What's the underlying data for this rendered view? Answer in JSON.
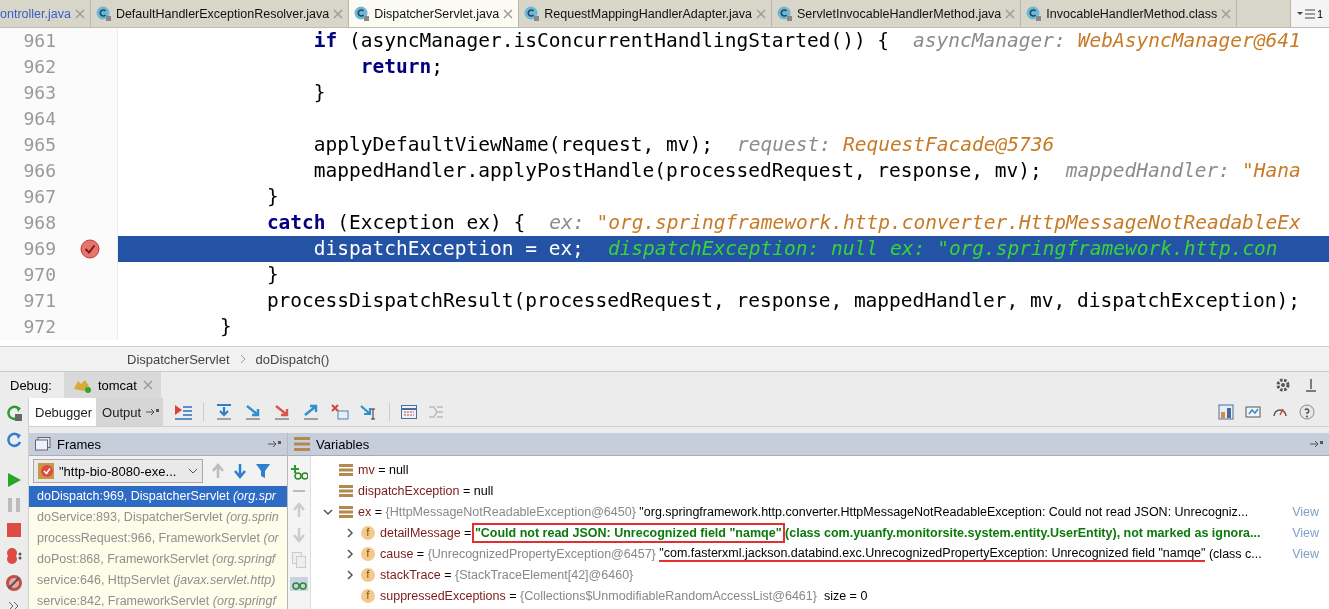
{
  "editor_tabs": [
    {
      "label": "ontroller.java",
      "selected": false,
      "icon": false
    },
    {
      "label": "DefaultHandlerExceptionResolver.java",
      "selected": false,
      "icon": true
    },
    {
      "label": "DispatcherServlet.java",
      "selected": true,
      "icon": true
    },
    {
      "label": "RequestMappingHandlerAdapter.java",
      "selected": false,
      "icon": true
    },
    {
      "label": "ServletInvocableHandlerMethod.java",
      "selected": false,
      "icon": true
    },
    {
      "label": "InvocableHandlerMethod.class",
      "selected": false,
      "icon": true
    }
  ],
  "tab_overflow": "1",
  "code_lines": [
    {
      "number": "961",
      "selected": false,
      "breakpoint": false,
      "segments": [
        {
          "kind": "keyword",
          "text": "                if"
        },
        {
          "kind": "code",
          "text": " (asyncManager.isConcurrentHandlingStarted()) {"
        },
        {
          "kind": "hint",
          "text": "asyncManager:"
        },
        {
          "kind": "hint_value",
          "text": "WebAsyncManager@641"
        }
      ]
    },
    {
      "number": "962",
      "selected": false,
      "breakpoint": false,
      "segments": [
        {
          "kind": "keyword",
          "text": "                    return"
        },
        {
          "kind": "code",
          "text": ";"
        }
      ]
    },
    {
      "number": "963",
      "selected": false,
      "breakpoint": false,
      "segments": [
        {
          "kind": "code",
          "text": "                }"
        }
      ]
    },
    {
      "number": "964",
      "selected": false,
      "breakpoint": false
    },
    {
      "number": "965",
      "selected": false,
      "breakpoint": false,
      "segments": [
        {
          "kind": "code",
          "text": "                applyDefaultViewName(request, mv);"
        },
        {
          "kind": "hint",
          "text": "request:"
        },
        {
          "kind": "hint_value",
          "text": "RequestFacade@5736"
        }
      ]
    },
    {
      "number": "966",
      "selected": false,
      "breakpoint": false,
      "segments": [
        {
          "kind": "code",
          "text": "                mappedHandler.applyPostHandle(processedRequest, response, mv);"
        },
        {
          "kind": "hint",
          "text": "mappedHandler:"
        },
        {
          "kind": "hint_value",
          "text": "\"Hana"
        }
      ]
    },
    {
      "number": "967",
      "selected": false,
      "breakpoint": false,
      "segments": [
        {
          "kind": "code",
          "text": "            }"
        }
      ]
    },
    {
      "number": "968",
      "selected": false,
      "breakpoint": false,
      "segments": [
        {
          "kind": "keyword",
          "text": "            catch"
        },
        {
          "kind": "code",
          "text": " (Exception ex) {"
        },
        {
          "kind": "hint",
          "text": "ex:"
        },
        {
          "kind": "hint_value",
          "text": "\"org.springframework.http.converter.HttpMessageNotReadableEx"
        }
      ]
    },
    {
      "number": "969",
      "selected": true,
      "breakpoint": true,
      "segments": [
        {
          "kind": "code",
          "text": "                dispatchException = ex;"
        },
        {
          "kind": "hint",
          "text": "dispatchException: null"
        },
        {
          "kind": "hint",
          "text": "ex:"
        },
        {
          "kind": "hint_value",
          "text": "\"org.springframework.http.con"
        }
      ]
    },
    {
      "number": "970",
      "selected": false,
      "breakpoint": false,
      "segments": [
        {
          "kind": "code",
          "text": "            }"
        }
      ]
    },
    {
      "number": "971",
      "selected": false,
      "breakpoint": false,
      "segments": [
        {
          "kind": "code",
          "text": "            processDispatchResult(processedRequest, response, mappedHandler, mv, dispatchException);"
        }
      ]
    },
    {
      "number": "972",
      "selected": false,
      "breakpoint": false,
      "segments": [
        {
          "kind": "code",
          "text": "        }"
        }
      ]
    }
  ],
  "breadcrumbs": [
    "DispatcherServlet",
    "doDispatch()"
  ],
  "debug": {
    "label": "Debug:",
    "session_tab": "tomcat",
    "tabs": [
      {
        "label": "Debugger",
        "selected": true
      },
      {
        "label": "Output",
        "selected": false
      }
    ],
    "frames": {
      "title": "Frames",
      "thread": "\"http-bio-8080-exe...",
      "items": [
        {
          "method": "doDispatch:969, DispatcherServlet",
          "package": "(org.spr",
          "selected": true
        },
        {
          "method": "doService:893, DispatcherServlet",
          "package": "(org.sprin",
          "selected": false
        },
        {
          "method": "processRequest:966, FrameworkServlet",
          "package": "(or",
          "selected": false
        },
        {
          "method": "doPost:868, FrameworkServlet",
          "package": "(org.springf",
          "selected": false
        },
        {
          "method": "service:646, HttpServlet",
          "package": "(javax.servlet.http)",
          "selected": false
        },
        {
          "method": "service:842, FrameworkServlet",
          "package": "(org.springf",
          "selected": false
        }
      ]
    },
    "variables": {
      "title": "Variables",
      "items": [
        {
          "kind": "local",
          "name": "mv",
          "eq": "=",
          "value": [
            {
              "text": "null"
            }
          ]
        },
        {
          "kind": "local",
          "name": "dispatchException",
          "eq": "=",
          "value": [
            {
              "text": "null"
            }
          ]
        },
        {
          "kind": "local",
          "name": "ex",
          "eq": "=",
          "expanded": true,
          "type": "{HttpMessageNotReadableException@6450}",
          "value": [
            {
              "text": "\"org.springframework.http.converter.HttpMessageNotReadableException: Could not read JSON: Unrecogniz..."
            }
          ],
          "link": "View",
          "children": [
            {
              "kind": "field",
              "badge": "f",
              "name": "detailMessage",
              "eq": "=",
              "expanded": false,
              "emphasis": true,
              "value": [
                {
                  "text": "\"Could not read JSON: Unrecognized field \"namqe\"",
                  "boxed": true
                },
                {
                  "text": " (class com.yuanfy.monitorsite.system.entity.UserEntity), not marked as ignora..."
                }
              ],
              "link": "View"
            },
            {
              "kind": "field",
              "badge": "f",
              "name": "cause",
              "eq": "=",
              "expanded": false,
              "type": "{UnrecognizedPropertyException@6457}",
              "value": [
                {
                  "text": "\"com.fasterxml.jackson.databind.exc.UnrecognizedPropertyException: Unrecognized field \"namqe\"",
                  "underlined": true
                },
                {
                  "text": " (class c..."
                }
              ],
              "link": "View"
            },
            {
              "kind": "field",
              "badge": "f",
              "name": "stackTrace",
              "eq": "=",
              "expanded": false,
              "type": "{StackTraceElement[42]@6460}"
            },
            {
              "kind": "field",
              "badge": "f",
              "name": "suppressedExceptions",
              "eq": "=",
              "type": "{Collections$UnmodifiableRandomAccessList@6461}",
              "extra": "size = 0"
            }
          ]
        }
      ]
    }
  }
}
